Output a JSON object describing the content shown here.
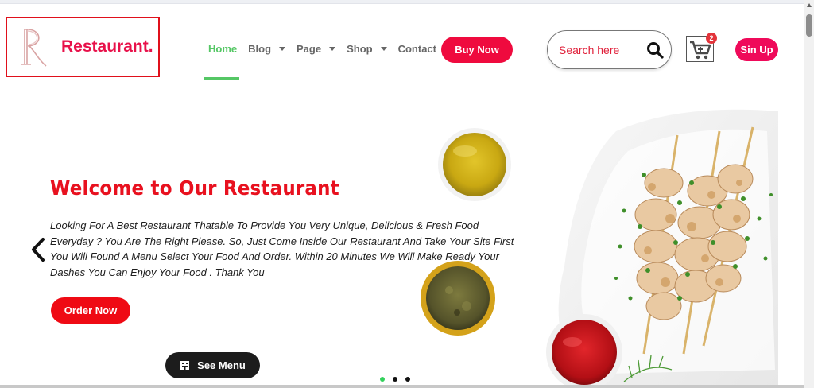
{
  "brand": {
    "name": "Restaurant.",
    "mark_letter": "R",
    "accent_color": "#e8114a"
  },
  "nav": {
    "items": [
      {
        "label": "Home",
        "active": true,
        "has_dropdown": false
      },
      {
        "label": "Blog",
        "active": false,
        "has_dropdown": true
      },
      {
        "label": "Page",
        "active": false,
        "has_dropdown": true
      },
      {
        "label": "Shop",
        "active": false,
        "has_dropdown": true
      },
      {
        "label": "Contact",
        "active": false,
        "has_dropdown": false
      }
    ],
    "active_color": "#55c765"
  },
  "header": {
    "buy_label": "Buy Now",
    "search_placeholder": "Search here",
    "search_value": "",
    "cart_count": "2",
    "signup_label": "Sin Up"
  },
  "hero": {
    "title": "Welcome to Our Restaurant",
    "text": "Looking For A Best Restaurant Thatable To Provide You Very Unique, Delicious & Fresh Food Everyday ? You Are The Right Please. So, Just Come Inside Our Restaurant And Take Your Site First You Will Found A Menu Select Your Food And Order. Within 20 Minutes We Will Make Ready Your Dashes You Can Enjoy Your Food . Thank You",
    "order_label": "Order Now",
    "menu_label": "See Menu",
    "slide_count": 3,
    "active_slide": 1,
    "title_color": "#e8111f"
  },
  "icons": {
    "search": "search-icon",
    "cart": "cart-icon",
    "prev": "chevron-left-icon",
    "next": "chevron-right-icon",
    "menu": "menu-book-icon"
  }
}
